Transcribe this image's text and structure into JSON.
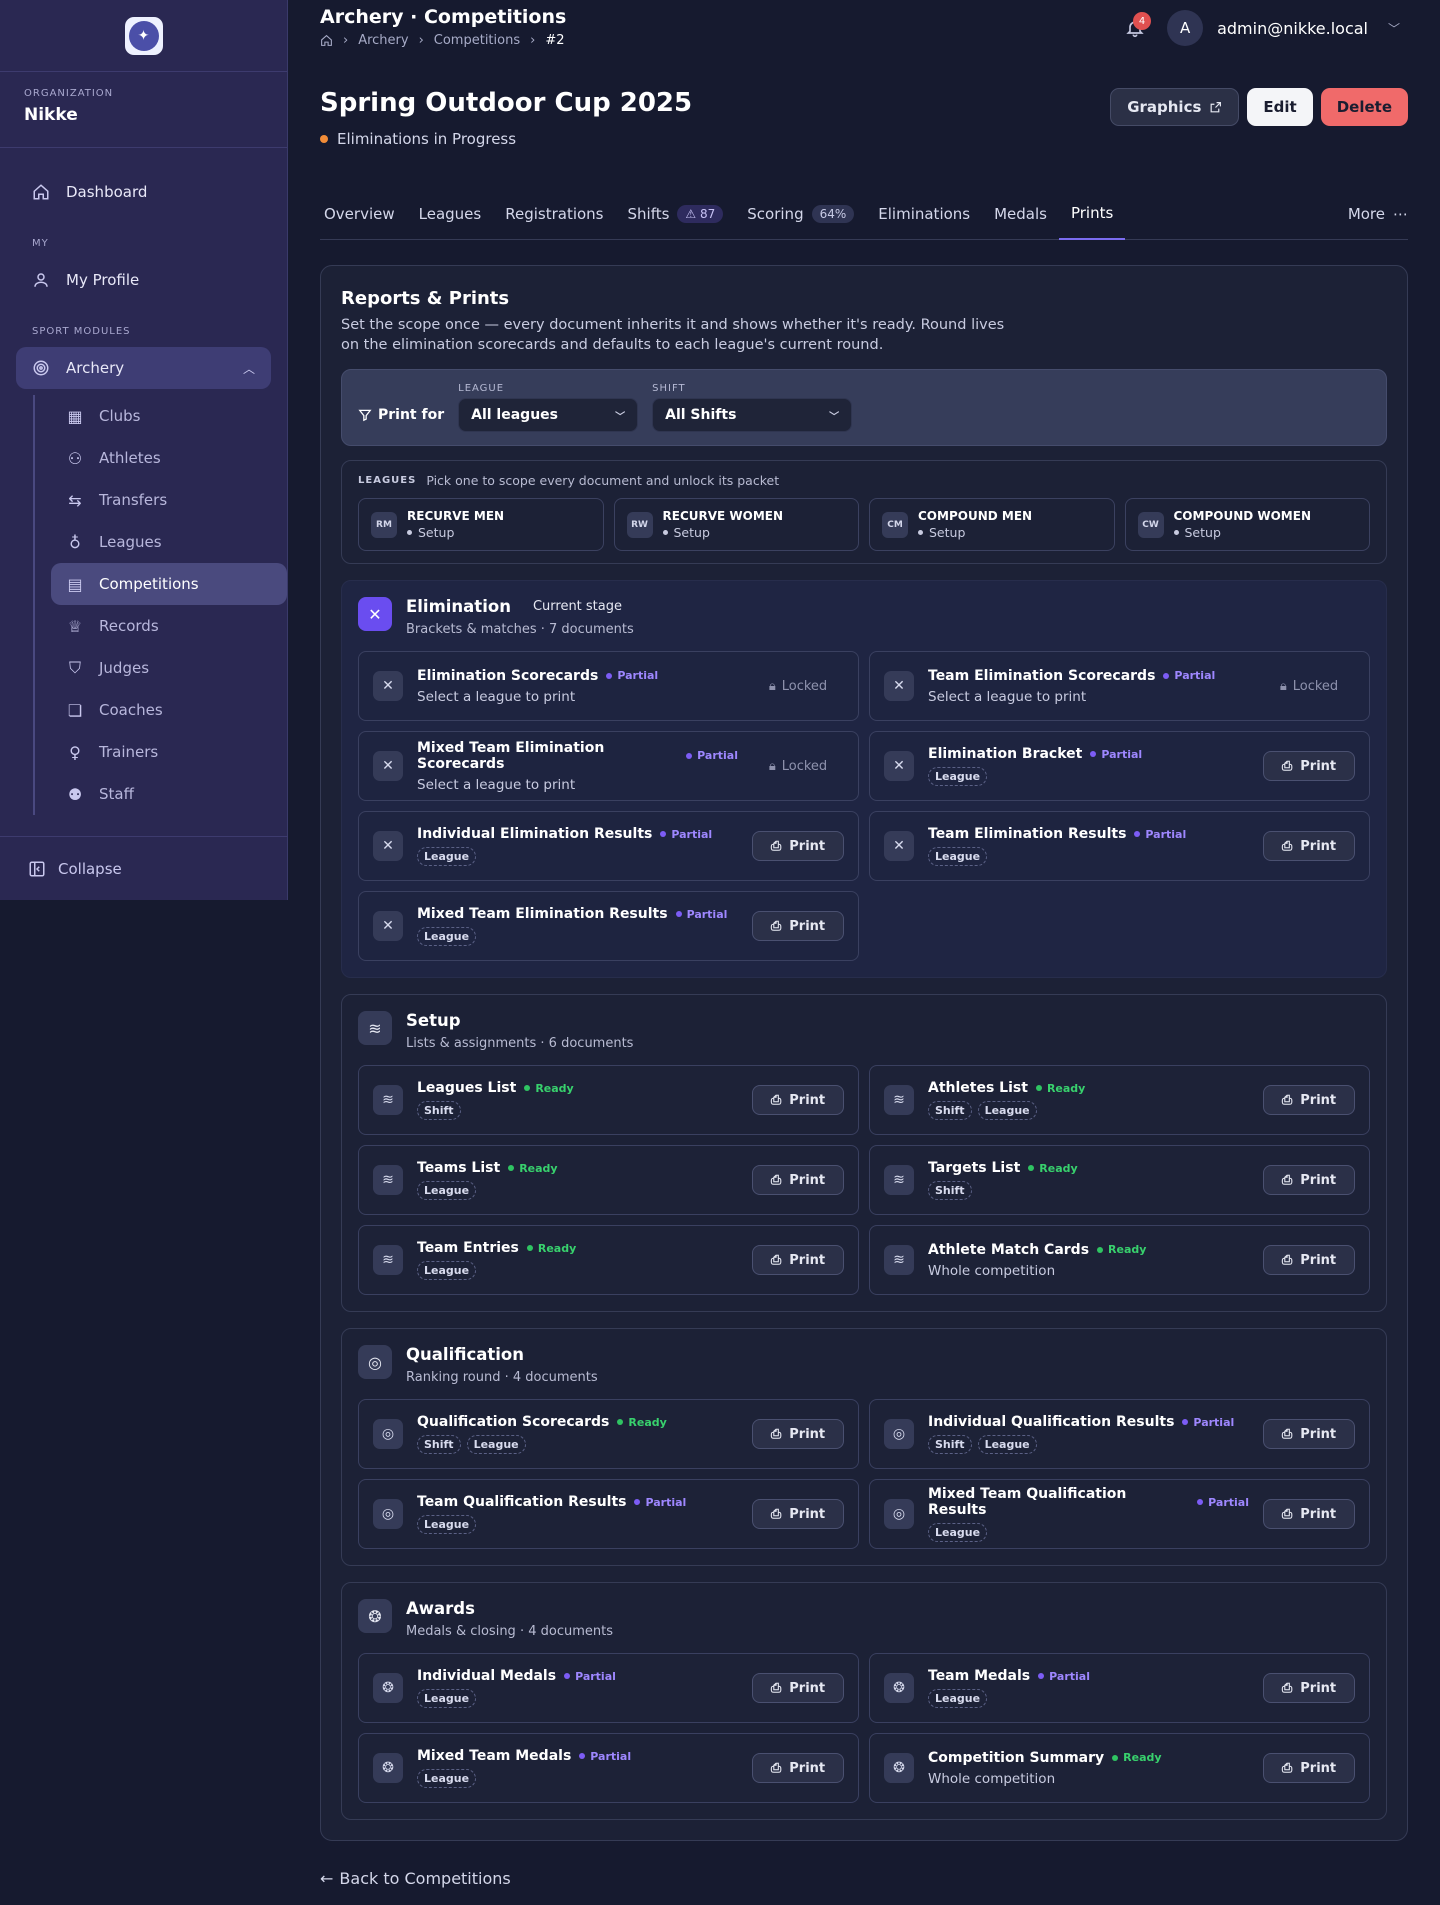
{
  "sidebar": {
    "org_label": "ORGANIZATION",
    "org_name": "Nikke",
    "dashboard": "Dashboard",
    "my_label": "MY",
    "my_profile": "My Profile",
    "modules_label": "SPORT MODULES",
    "archery": "Archery",
    "items": [
      {
        "label": "Clubs",
        "icon": "building-icon"
      },
      {
        "label": "Athletes",
        "icon": "user-icon"
      },
      {
        "label": "Transfers",
        "icon": "arrows-icon"
      },
      {
        "label": "Leagues",
        "icon": "award-icon"
      },
      {
        "label": "Competitions",
        "icon": "calendar-icon"
      },
      {
        "label": "Records",
        "icon": "trophy-icon"
      },
      {
        "label": "Judges",
        "icon": "shield-icon"
      },
      {
        "label": "Coaches",
        "icon": "book-icon"
      },
      {
        "label": "Trainers",
        "icon": "bulb-icon"
      },
      {
        "label": "Staff",
        "icon": "users-icon"
      }
    ],
    "collapse": "Collapse"
  },
  "topbar": {
    "title": "Archery · Competitions",
    "crumbs": [
      "Archery",
      "Competitions",
      "#2"
    ],
    "notif_count": "4",
    "avatar": "A",
    "user": "admin@nikke.local"
  },
  "header": {
    "title": "Spring Outdoor Cup 2025",
    "status": "Eliminations in Progress",
    "graphics": "Graphics",
    "edit": "Edit",
    "delete": "Delete"
  },
  "tabs": {
    "overview": "Overview",
    "leagues": "Leagues",
    "registrations": "Registrations",
    "shifts": "Shifts",
    "shifts_count": "87",
    "scoring": "Scoring",
    "scoring_pct": "64%",
    "eliminations": "Eliminations",
    "medals": "Medals",
    "prints": "Prints",
    "more": "More"
  },
  "reports": {
    "title": "Reports & Prints",
    "desc": "Set the scope once — every document inherits it and shows whether it's ready. Round lives on the elimination scorecards and defaults to each league's current round.",
    "print_for": "Print for",
    "league_label": "LEAGUE",
    "league_value": "All leagues",
    "shift_label": "SHIFT",
    "shift_value": "All Shifts",
    "leagues_label": "LEAGUES",
    "leagues_hint": "Pick one to scope every document and unlock its packet",
    "leagues": [
      {
        "abbr": "RM",
        "name": "RECURVE MEN",
        "status": "Setup"
      },
      {
        "abbr": "RW",
        "name": "RECURVE WOMEN",
        "status": "Setup"
      },
      {
        "abbr": "CM",
        "name": "COMPOUND MEN",
        "status": "Setup"
      },
      {
        "abbr": "CW",
        "name": "COMPOUND WOMEN",
        "status": "Setup"
      }
    ]
  },
  "common": {
    "print": "Print",
    "locked": "Locked",
    "partial": "Partial",
    "ready": "Ready",
    "shift": "Shift",
    "league": "League",
    "select_league": "Select a league to print",
    "whole": "Whole competition"
  },
  "elimination": {
    "title": "Elimination",
    "stage": "Current stage",
    "sub": "Brackets & matches · 7 documents",
    "docs": [
      "Elimination Scorecards",
      "Team Elimination Scorecards",
      "Mixed Team Elimination Scorecards",
      "Elimination Bracket",
      "Individual Elimination Results",
      "Team Elimination Results",
      "Mixed Team Elimination Results"
    ]
  },
  "setup": {
    "title": "Setup",
    "sub": "Lists & assignments · 6 documents",
    "docs": [
      "Leagues List",
      "Athletes List",
      "Teams List",
      "Targets List",
      "Team Entries",
      "Athlete Match Cards"
    ]
  },
  "qualification": {
    "title": "Qualification",
    "sub": "Ranking round · 4 documents",
    "docs": [
      "Qualification Scorecards",
      "Individual Qualification Results",
      "Team Qualification Results",
      "Mixed Team Qualification Results"
    ]
  },
  "awards": {
    "title": "Awards",
    "sub": "Medals & closing · 4 documents",
    "docs": [
      "Individual Medals",
      "Team Medals",
      "Mixed Team Medals",
      "Competition Summary"
    ]
  },
  "back": "Back to Competitions",
  "colors": {
    "accent": "#7b6cf0",
    "ready": "#2fc462",
    "partial": "#7c5cf5",
    "delete": "#f06a6a",
    "status_dot": "#f28c38"
  }
}
